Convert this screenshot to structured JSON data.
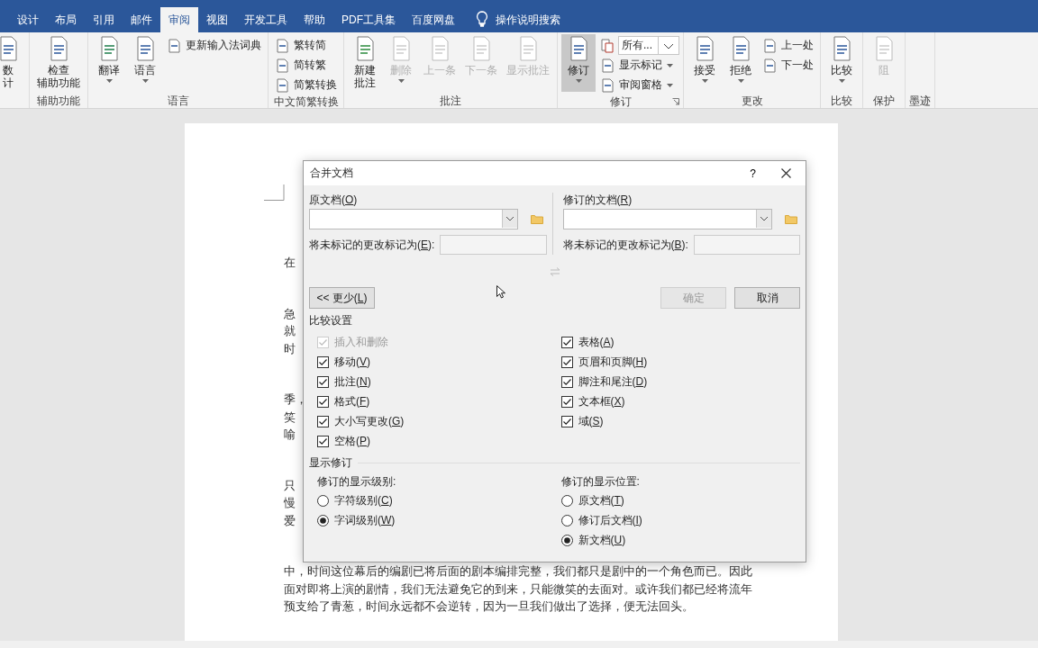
{
  "ribbon": {
    "tabs": [
      {
        "label": "设计",
        "selected": false
      },
      {
        "label": "布局",
        "selected": false
      },
      {
        "label": "引用",
        "selected": false
      },
      {
        "label": "邮件",
        "selected": false
      },
      {
        "label": "审阅",
        "selected": true
      },
      {
        "label": "视图",
        "selected": false
      },
      {
        "label": "开发工具",
        "selected": false
      },
      {
        "label": "帮助",
        "selected": false
      },
      {
        "label": "PDF工具集",
        "selected": false
      },
      {
        "label": "百度网盘",
        "selected": false
      }
    ],
    "tell_me": "操作说明搜索",
    "groups": [
      {
        "items": [
          {
            "kind": "large",
            "lines": [
              "数",
              "计"
            ],
            "dropdown": false,
            "disabled": false,
            "selected": false
          }
        ]
      },
      {
        "label": "辅助功能",
        "items": [
          {
            "kind": "large",
            "lines": [
              "检查",
              "辅助功能"
            ],
            "dropdown": false,
            "disabled": false,
            "selected": false
          }
        ]
      },
      {
        "label": "语言",
        "items": [
          {
            "kind": "large",
            "lines": [
              "翻译"
            ],
            "dropdown": true,
            "disabled": false,
            "selected": false
          },
          {
            "kind": "large",
            "lines": [
              "语言"
            ],
            "dropdown": true,
            "disabled": false,
            "selected": false
          },
          {
            "kind": "stack",
            "items": [
              {
                "kind": "small",
                "label": "更新输入法词典",
                "dropdown": false
              }
            ]
          }
        ]
      },
      {
        "label": "中文简繁转换",
        "items": [
          {
            "kind": "stack",
            "items": [
              {
                "kind": "small",
                "label": "繁转简",
                "dropdown": false
              },
              {
                "kind": "small",
                "label": "简转繁",
                "dropdown": false
              },
              {
                "kind": "small",
                "label": "简繁转换",
                "dropdown": false
              }
            ]
          }
        ]
      },
      {
        "label": "批注",
        "items": [
          {
            "kind": "large",
            "lines": [
              "新建",
              "批注"
            ],
            "dropdown": false,
            "disabled": false,
            "selected": false
          },
          {
            "kind": "large",
            "lines": [
              "删除"
            ],
            "dropdown": true,
            "disabled": true,
            "selected": false
          },
          {
            "kind": "large",
            "lines": [
              "上一条"
            ],
            "dropdown": false,
            "disabled": true,
            "selected": false
          },
          {
            "kind": "large",
            "lines": [
              "下一条"
            ],
            "dropdown": false,
            "disabled": true,
            "selected": false
          },
          {
            "kind": "large",
            "lines": [
              "显示批注"
            ],
            "dropdown": false,
            "disabled": true,
            "selected": false
          }
        ]
      },
      {
        "label": "修订",
        "launcher": true,
        "items": [
          {
            "kind": "large",
            "lines": [
              "修订"
            ],
            "dropdown": true,
            "disabled": false,
            "selected": true
          },
          {
            "kind": "stack",
            "items": [
              {
                "kind": "combo",
                "label": "所有..."
              },
              {
                "kind": "small",
                "label": "显示标记",
                "dropdown": true
              },
              {
                "kind": "small",
                "label": "审阅窗格",
                "dropdown": true
              }
            ]
          }
        ]
      },
      {
        "label": "更改",
        "items": [
          {
            "kind": "large",
            "lines": [
              "接受"
            ],
            "dropdown": true,
            "disabled": false,
            "selected": false
          },
          {
            "kind": "large",
            "lines": [
              "拒绝"
            ],
            "dropdown": true,
            "disabled": false,
            "selected": false
          },
          {
            "kind": "stack",
            "items": [
              {
                "kind": "small",
                "label": "上一处",
                "dropdown": false
              },
              {
                "kind": "small",
                "label": "下一处",
                "dropdown": false
              }
            ]
          }
        ]
      },
      {
        "label": "比较",
        "items": [
          {
            "kind": "large",
            "lines": [
              "比较"
            ],
            "dropdown": true,
            "disabled": false,
            "selected": false
          }
        ]
      },
      {
        "label": "保护",
        "items": [
          {
            "kind": "large",
            "lines": [
              "阻"
            ],
            "dropdown": false,
            "disabled": true,
            "selected": false
          }
        ]
      },
      {
        "label": "墨迹"
      }
    ]
  },
  "document": {
    "paragraphs": [
      [
        "在"
      ],
      [
        "急",
        "就",
        "时"
      ],
      [
        "季，",
        "笑",
        "喻"
      ],
      [
        "只",
        "慢",
        "爱"
      ],
      [
        "中，时间这位幕后的编剧已将后面的剧本编排完整，我们都只是剧中的一个角色而已。因此",
        "面对即将上演的剧情，我们无法避免它的到来，只能微笑的去面对。或许我们都已经将流年",
        "预支给了青葱，时间永远都不会逆转，因为一旦我们做出了选择，便无法回头。"
      ]
    ]
  },
  "dialog": {
    "title": "合并文档",
    "help": "?",
    "original": {
      "label": "原文档(O)",
      "mark_label": "将未标记的更改标记为(E):"
    },
    "revised": {
      "label": "修订的文档(R)",
      "mark_label": "将未标记的更改标记为(B):"
    },
    "less_button": "<< 更少(L)",
    "ok_button": {
      "label": "确定",
      "disabled": true
    },
    "cancel_button": "取消",
    "compare_settings": {
      "title": "比较设置",
      "left": [
        {
          "label": "插入和删除",
          "checked": true,
          "disabled": true
        },
        {
          "label": "移动(V)",
          "checked": true,
          "disabled": false
        },
        {
          "label": "批注(N)",
          "checked": true,
          "disabled": false
        },
        {
          "label": "格式(F)",
          "checked": true,
          "disabled": false
        },
        {
          "label": "大小写更改(G)",
          "checked": true,
          "disabled": false
        },
        {
          "label": "空格(P)",
          "checked": true,
          "disabled": false
        }
      ],
      "right": [
        {
          "label": "表格(A)",
          "checked": true,
          "disabled": false
        },
        {
          "label": "页眉和页脚(H)",
          "checked": true,
          "disabled": false
        },
        {
          "label": "脚注和尾注(D)",
          "checked": true,
          "disabled": false
        },
        {
          "label": "文本框(X)",
          "checked": true,
          "disabled": false
        },
        {
          "label": "域(S)",
          "checked": true,
          "disabled": false
        }
      ]
    },
    "show_changes": {
      "title": "显示修订",
      "level": {
        "title": "修订的显示级别:",
        "options": [
          {
            "label": "字符级别(C)",
            "selected": false
          },
          {
            "label": "字词级别(W)",
            "selected": true
          }
        ]
      },
      "location": {
        "title": "修订的显示位置:",
        "options": [
          {
            "label": "原文档(T)",
            "selected": false
          },
          {
            "label": "修订后文档(I)",
            "selected": false
          },
          {
            "label": "新文档(U)",
            "selected": true
          }
        ]
      }
    }
  }
}
